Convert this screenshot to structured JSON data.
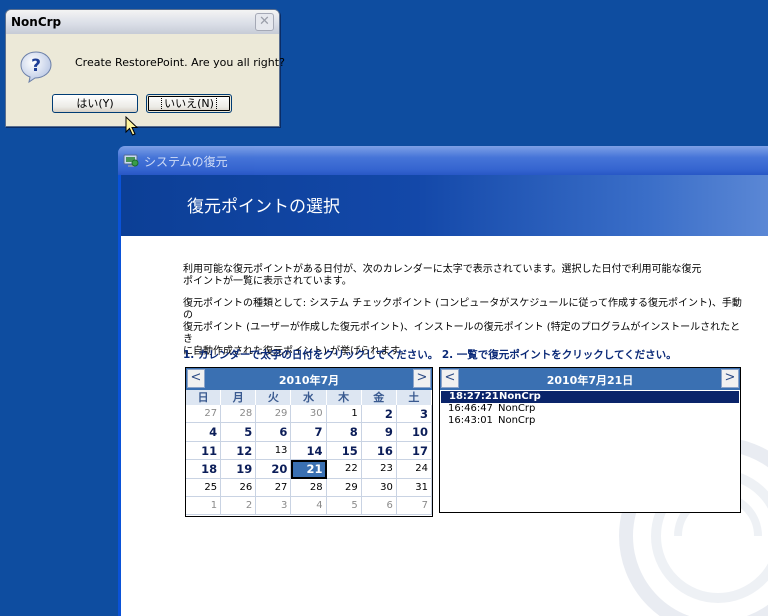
{
  "dialog": {
    "title": "NonCrp",
    "close_glyph": "✕",
    "message": "Create RestorePoint. Are you all right?",
    "yes_label": "はい(Y)",
    "no_label": "いいえ(N)"
  },
  "window": {
    "title": "システムの復元",
    "header_title": "復元ポイントの選択",
    "para1_line1": "利用可能な復元ポイントがある日付が、次のカレンダーに太字で表示されています。選択した日付で利用可能な復元",
    "para1_line2": "ポイントが一覧に表示されています。",
    "para2_line1": "復元ポイントの種類として: システム チェックポイント (コンピュータがスケジュールに従って作成する復元ポイント)、手動の",
    "para2_line2": "復元ポイント (ユーザーが作成した復元ポイント)、インストールの復元ポイント (特定のプログラムがインストールされたとき",
    "para2_line3": "に自動作成された復元ポイント) が挙げられます。",
    "step_text": "1. カレンダーで太字の日付をクリックしてください。 2. 一覧で復元ポイントをクリックしてください。"
  },
  "calendar": {
    "prev": "<",
    "next": ">",
    "month": "2010年7月",
    "dow": [
      "日",
      "月",
      "火",
      "水",
      "木",
      "金",
      "土"
    ],
    "weeks": [
      [
        {
          "d": "27",
          "m": 1
        },
        {
          "d": "28",
          "m": 1
        },
        {
          "d": "29",
          "m": 1
        },
        {
          "d": "30",
          "m": 1
        },
        {
          "d": "1"
        },
        {
          "d": "2",
          "b": 1
        },
        {
          "d": "3",
          "b": 1
        }
      ],
      [
        {
          "d": "4",
          "b": 1
        },
        {
          "d": "5",
          "b": 1
        },
        {
          "d": "6",
          "b": 1
        },
        {
          "d": "7",
          "b": 1
        },
        {
          "d": "8",
          "b": 1
        },
        {
          "d": "9",
          "b": 1
        },
        {
          "d": "10",
          "b": 1
        }
      ],
      [
        {
          "d": "11",
          "b": 1
        },
        {
          "d": "12",
          "b": 1
        },
        {
          "d": "13"
        },
        {
          "d": "14",
          "b": 1
        },
        {
          "d": "15",
          "b": 1
        },
        {
          "d": "16",
          "b": 1
        },
        {
          "d": "17",
          "b": 1
        }
      ],
      [
        {
          "d": "18",
          "b": 1
        },
        {
          "d": "19",
          "b": 1
        },
        {
          "d": "20",
          "b": 1
        },
        {
          "d": "21",
          "b": 1,
          "s": 1
        },
        {
          "d": "22"
        },
        {
          "d": "23"
        },
        {
          "d": "24"
        }
      ],
      [
        {
          "d": "25"
        },
        {
          "d": "26"
        },
        {
          "d": "27"
        },
        {
          "d": "28"
        },
        {
          "d": "29"
        },
        {
          "d": "30"
        },
        {
          "d": "31"
        }
      ],
      [
        {
          "d": "1",
          "m": 1
        },
        {
          "d": "2",
          "m": 1
        },
        {
          "d": "3",
          "m": 1
        },
        {
          "d": "4",
          "m": 1
        },
        {
          "d": "5",
          "m": 1
        },
        {
          "d": "6",
          "m": 1
        },
        {
          "d": "7",
          "m": 1
        }
      ]
    ]
  },
  "restore_points": {
    "prev": "<",
    "next": ">",
    "date": "2010年7月21日",
    "items": [
      {
        "time": "18:27:21",
        "name": "NonCrp",
        "selected": true
      },
      {
        "time": "16:46:47",
        "name": "NonCrp",
        "selected": false
      },
      {
        "time": "16:43:01",
        "name": "NonCrp",
        "selected": false
      }
    ]
  },
  "colors": {
    "desktop": "#0e4da0",
    "accent": "#3a70b2",
    "selection": "#0a246a"
  }
}
